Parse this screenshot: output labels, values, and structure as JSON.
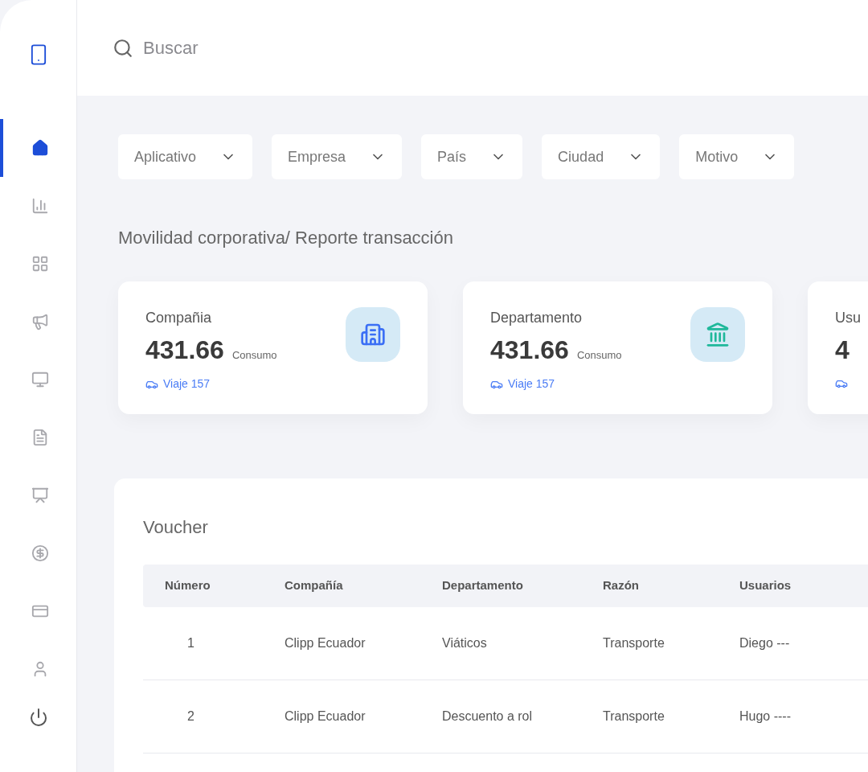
{
  "sidebar": {
    "items": [
      {
        "kind": "home",
        "selected": true
      },
      {
        "kind": "chart",
        "selected": false
      },
      {
        "kind": "grid",
        "selected": false
      },
      {
        "kind": "megaphone",
        "selected": false
      },
      {
        "kind": "monitor",
        "selected": false
      },
      {
        "kind": "file",
        "selected": false
      },
      {
        "kind": "presentation",
        "selected": false
      },
      {
        "kind": "dollar",
        "selected": false
      },
      {
        "kind": "card",
        "selected": false
      },
      {
        "kind": "user",
        "selected": false
      }
    ]
  },
  "search": {
    "placeholder": "Buscar"
  },
  "filters": [
    "Aplicativo",
    "Empresa",
    "País",
    "Ciudad",
    "Motivo"
  ],
  "breadcrumb": "Movilidad corporativa/ Reporte transacción",
  "cards": [
    {
      "title": "Compañia",
      "value": "431.66",
      "unit": "Consumo",
      "link": "Viaje 157"
    },
    {
      "title": "Departamento",
      "value": "431.66",
      "unit": "Consumo",
      "link": "Viaje 157"
    },
    {
      "title": "Usu",
      "value": "4"
    }
  ],
  "table": {
    "title": "Voucher",
    "columns": [
      "Número",
      "Compañía",
      "Departamento",
      "Razón",
      "Usuarios"
    ],
    "rows": [
      [
        "1",
        "Clipp Ecuador",
        "Viáticos",
        "Transporte",
        "Diego ---"
      ],
      [
        "2",
        "Clipp Ecuador",
        "Descuento a rol",
        "Transporte",
        "Hugo ----"
      ]
    ]
  }
}
